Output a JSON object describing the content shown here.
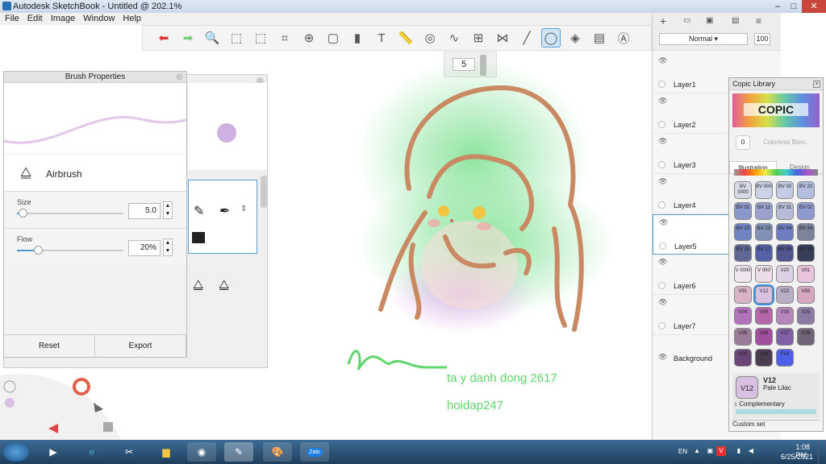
{
  "window": {
    "title": "Autodesk SketchBook - Untitled @ 202.1%",
    "minimize": "–",
    "maximize": "□",
    "close": "✕"
  },
  "menu": [
    "File",
    "Edit",
    "Image",
    "Window",
    "Help"
  ],
  "toolbar": {
    "icons": [
      "undo-icon",
      "redo-icon",
      "zoom-icon",
      "select-icon",
      "crop-select-icon",
      "crop-icon",
      "transform-icon",
      "distort-icon",
      "bucket-icon",
      "text-icon",
      "ruler-icon",
      "ellipse-icon",
      "french-curve-icon",
      "perspective-icon",
      "symmetry-icon",
      "line-icon",
      "circle-tool-icon",
      "shape-icon",
      "layer-stack-icon",
      "brushes-icon"
    ],
    "glyphs": [
      "⬅",
      "➡",
      "🔍",
      "⬚",
      "⬚",
      "⌗",
      "⊕",
      "▢",
      "▮",
      "T",
      "📏",
      "◎",
      "∿",
      "⊞",
      "⋈",
      "╱",
      "◯",
      "◈",
      "▤",
      "Ⓐ"
    ],
    "active_index": 16
  },
  "brush_size_value": "5",
  "canvas": {
    "text_line1": "ta y danh dong 2617",
    "text_line2": "hoidap247"
  },
  "brush_properties": {
    "title": "Brush Properties",
    "brush_name": "Airbrush",
    "size_label": "Size",
    "size_value": "5.0",
    "size_fraction": 0.05,
    "flow_label": "Flow",
    "flow_value": "20%",
    "flow_fraction": 0.2,
    "reset_label": "Reset",
    "export_label": "Export"
  },
  "layers_panel": {
    "blend_mode": "Normal",
    "opacity": "100",
    "layers": [
      {
        "name": "Layer1",
        "selected": false
      },
      {
        "name": "Layer2",
        "selected": false
      },
      {
        "name": "Layer3",
        "selected": false
      },
      {
        "name": "Layer4",
        "selected": false
      },
      {
        "name": "Layer5",
        "selected": true
      },
      {
        "name": "Layer6",
        "selected": false
      },
      {
        "name": "Layer7",
        "selected": false
      }
    ],
    "background_label": "Background"
  },
  "copic_library": {
    "title": "Copic Library",
    "logo_text": "COPIC",
    "colorless_label": "Colorless Blen...",
    "colorless_code": "0",
    "tabs": [
      {
        "label": "Illustration",
        "active": true
      },
      {
        "label": "Design",
        "active": false
      }
    ],
    "swatches": [
      {
        "code": "BV 0000",
        "color": "#d7dbe8"
      },
      {
        "code": "BV 000",
        "color": "#ccd2e6"
      },
      {
        "code": "BV 00",
        "color": "#c4cbe4"
      },
      {
        "code": "BV 20",
        "color": "#b3bde0"
      },
      {
        "code": "BV 01",
        "color": "#8a97c8"
      },
      {
        "code": "BV 11",
        "color": "#9aa1cc"
      },
      {
        "code": "BV 31",
        "color": "#b8bcd6"
      },
      {
        "code": "BV 02",
        "color": "#8f9ad0"
      },
      {
        "code": "BV 13",
        "color": "#6f83c0"
      },
      {
        "code": "BV 23",
        "color": "#8090b4"
      },
      {
        "code": "BV 04",
        "color": "#6d7dc0"
      },
      {
        "code": "BV 34",
        "color": "#7b8299"
      },
      {
        "code": "BV 25",
        "color": "#5f6894"
      },
      {
        "code": "BV 17",
        "color": "#5561a6"
      },
      {
        "code": "BV 08",
        "color": "#4f558e"
      },
      {
        "code": "BV 29",
        "color": "#383e58"
      },
      {
        "code": "V 0000",
        "color": "#eee6ec"
      },
      {
        "code": "V 000",
        "color": "#ecdde9"
      },
      {
        "code": "V20",
        "color": "#dcd0e4"
      },
      {
        "code": "V01",
        "color": "#e8c3dc"
      },
      {
        "code": "V91",
        "color": "#d9b4c4"
      },
      {
        "code": "V12",
        "color": "#d8c0e0"
      },
      {
        "code": "V22",
        "color": "#b8aec4"
      },
      {
        "code": "V93",
        "color": "#d7a7c0"
      },
      {
        "code": "V04",
        "color": "#b072b8"
      },
      {
        "code": "V05",
        "color": "#b568a8"
      },
      {
        "code": "V15",
        "color": "#b586bd"
      },
      {
        "code": "V25",
        "color": "#8a7aa4"
      },
      {
        "code": "V95",
        "color": "#9a7c98"
      },
      {
        "code": "V06",
        "color": "#a04f9c"
      },
      {
        "code": "V17",
        "color": "#8061a6"
      },
      {
        "code": "V28",
        "color": "#6f6478"
      },
      {
        "code": "V09",
        "color": "#6a4678"
      },
      {
        "code": "V99",
        "color": "#4a3d50"
      },
      {
        "code": "FV2",
        "color": "#4d5ee8"
      }
    ],
    "current": {
      "code": "V12",
      "name": "Pale Lilac",
      "color": "#d8c0e0"
    },
    "complementary_label": "Complementary",
    "custom_set_label": "Custom set"
  },
  "taskbar": {
    "apps": [
      "start-button",
      "media-player-icon",
      "internet-explorer-icon",
      "snipping-tool-icon",
      "file-explorer-icon",
      "chrome-icon",
      "sketchbook-icon",
      "paint-icon",
      "zalo-icon"
    ],
    "zalo_label": "Zalo",
    "language": "EN",
    "time": "1:08 PM",
    "date": "6/25/2021"
  }
}
